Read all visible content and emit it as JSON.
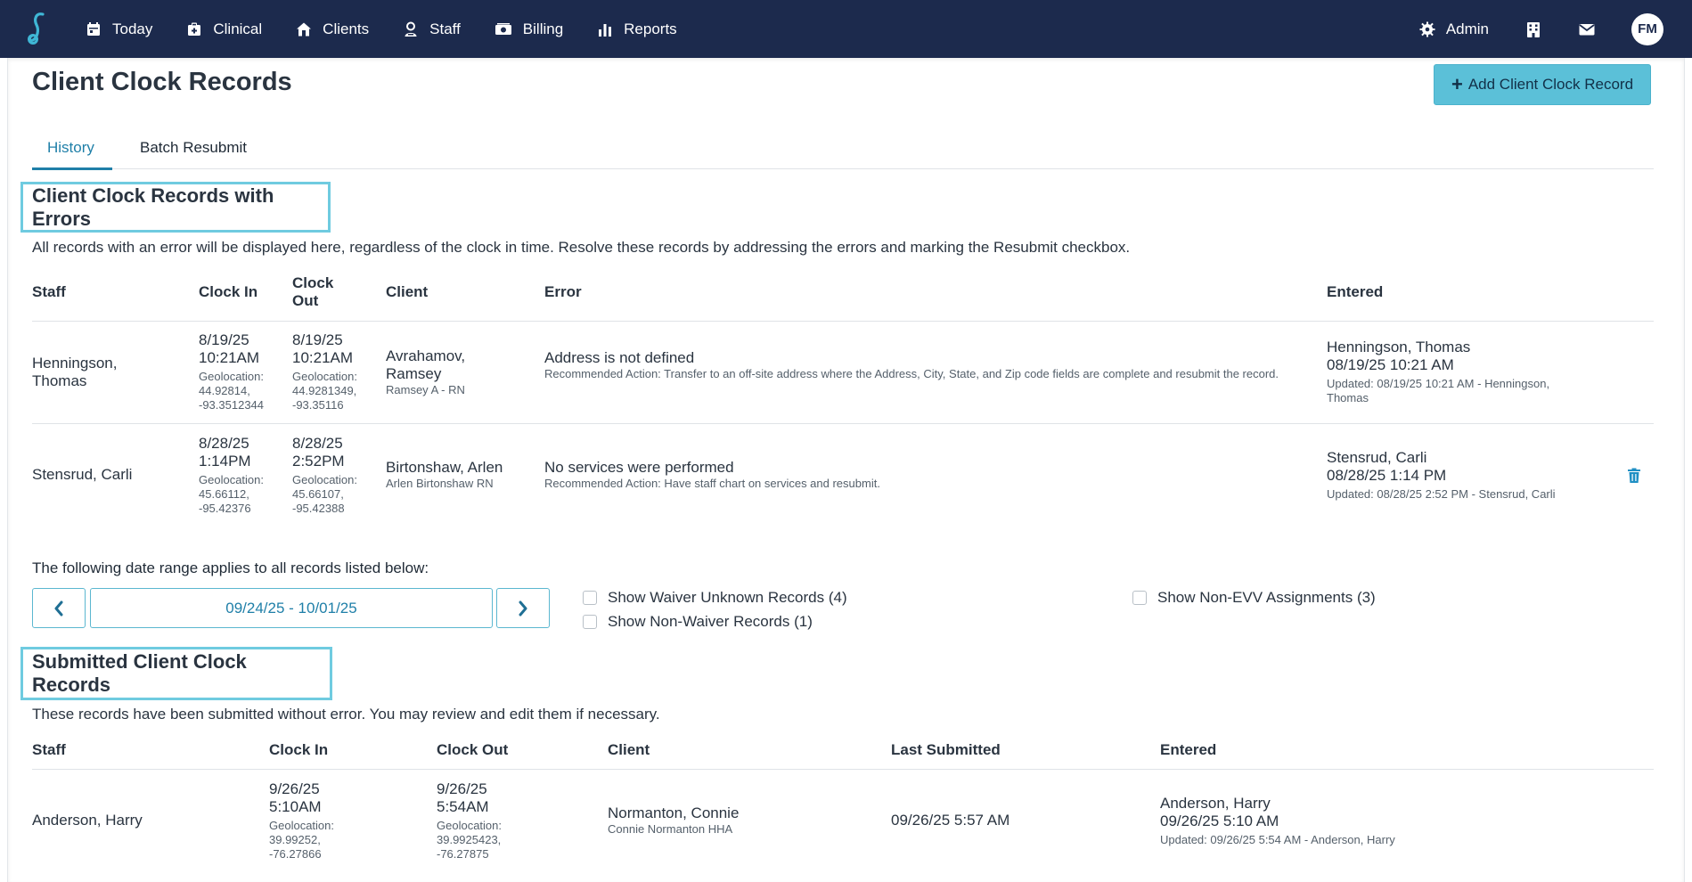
{
  "nav": {
    "items": [
      {
        "label": "Today",
        "icon": "calendar-icon"
      },
      {
        "label": "Clinical",
        "icon": "clipboard-icon"
      },
      {
        "label": "Clients",
        "icon": "house-icon"
      },
      {
        "label": "Staff",
        "icon": "person-icon"
      },
      {
        "label": "Billing",
        "icon": "money-icon"
      },
      {
        "label": "Reports",
        "icon": "bar-chart-icon"
      }
    ],
    "admin_label": "Admin",
    "avatar_initials": "FM"
  },
  "page": {
    "title": "Client Clock Records",
    "add_button_label": "Add Client Clock Record"
  },
  "tabs": [
    {
      "label": "History",
      "active": true
    },
    {
      "label": "Batch Resubmit",
      "active": false
    }
  ],
  "errors_section": {
    "title": "Client Clock Records with Errors",
    "description": "All records with an error will be displayed here, regardless of the clock in time. Resolve these records by addressing the errors and marking the Resubmit checkbox.",
    "columns": {
      "staff": "Staff",
      "clock_in": "Clock In",
      "clock_out_1": "Clock",
      "clock_out_2": "Out",
      "client": "Client",
      "error": "Error",
      "entered": "Entered"
    },
    "rows": [
      {
        "staff": "Henningson, Thomas",
        "clock_in_date": "8/19/25",
        "clock_in_time": "10:21AM",
        "clock_in_geo_label": "Geolocation:",
        "clock_in_geo_lat": "44.92814,",
        "clock_in_geo_lng": "-93.3512344",
        "clock_out_date": "8/19/25",
        "clock_out_time": "10:21AM",
        "clock_out_geo_label": "Geolocation:",
        "clock_out_geo_lat": "44.9281349,",
        "clock_out_geo_lng": "-93.35116",
        "client_name": "Avrahamov, Ramsey",
        "client_sub": "Ramsey A - RN",
        "error": "Address is not defined",
        "error_action": "Recommended Action: Transfer to an off-site address where the Address, City, State, and Zip code fields are complete and resubmit the record.",
        "entered_by": "Henningson, Thomas",
        "entered_at": "08/19/25 10:21 AM",
        "updated": "Updated: 08/19/25 10:21 AM - Henningson, Thomas"
      },
      {
        "staff": "Stensrud, Carli",
        "clock_in_date": "8/28/25",
        "clock_in_time": "1:14PM",
        "clock_in_geo_label": "Geolocation:",
        "clock_in_geo_lat": "45.66112,",
        "clock_in_geo_lng": "-95.42376",
        "clock_out_date": "8/28/25",
        "clock_out_time": "2:52PM",
        "clock_out_geo_label": "Geolocation:",
        "clock_out_geo_lat": "45.66107,",
        "clock_out_geo_lng": "-95.42388",
        "client_name": "Birtonshaw, Arlen",
        "client_sub": "Arlen Birtonshaw RN",
        "error": "No services were performed",
        "error_action": "Recommended Action: Have staff chart on services and resubmit.",
        "entered_by": "Stensrud, Carli",
        "entered_at": "08/28/25 1:14 PM",
        "updated": "Updated: 08/28/25 2:52 PM - Stensrud, Carli"
      }
    ]
  },
  "date_range": {
    "note": "The following date range applies to all records listed below:",
    "value": "09/24/25 - 10/01/25",
    "checkboxes": {
      "waiver_unknown": "Show Waiver Unknown Records (4)",
      "non_waiver": "Show Non-Waiver Records (1)",
      "non_evv": "Show Non-EVV Assignments (3)"
    }
  },
  "submitted_section": {
    "title": "Submitted Client Clock Records",
    "description": "These records have been submitted without error. You may review and edit them if necessary.",
    "columns": {
      "staff": "Staff",
      "clock_in": "Clock In",
      "clock_out": "Clock Out",
      "client": "Client",
      "last_submitted": "Last Submitted",
      "entered": "Entered"
    },
    "rows": [
      {
        "staff": "Anderson, Harry",
        "clock_in_date": "9/26/25",
        "clock_in_time": "5:10AM",
        "clock_in_geo_label": "Geolocation:",
        "clock_in_geo_lat": "39.99252,",
        "clock_in_geo_lng": "-76.27866",
        "clock_out_date": "9/26/25",
        "clock_out_time": "5:54AM",
        "clock_out_geo_label": "Geolocation:",
        "clock_out_geo_lat": "39.9925423,",
        "clock_out_geo_lng": "-76.27875",
        "client_name": "Normanton, Connie",
        "client_sub": "Connie Normanton HHA",
        "last_submitted": "09/26/25 5:57 AM",
        "entered_by": "Anderson, Harry",
        "entered_at": "09/26/25 5:10 AM",
        "updated": "Updated: 09/26/25 5:54 AM - Anderson, Harry"
      }
    ]
  },
  "colors": {
    "nav_bg": "#1c2a4d",
    "accent": "#1f7fa8",
    "add_button_bg": "#5bc0d8",
    "section_outline": "#6fcbe0",
    "trash": "#1f8fc4"
  }
}
